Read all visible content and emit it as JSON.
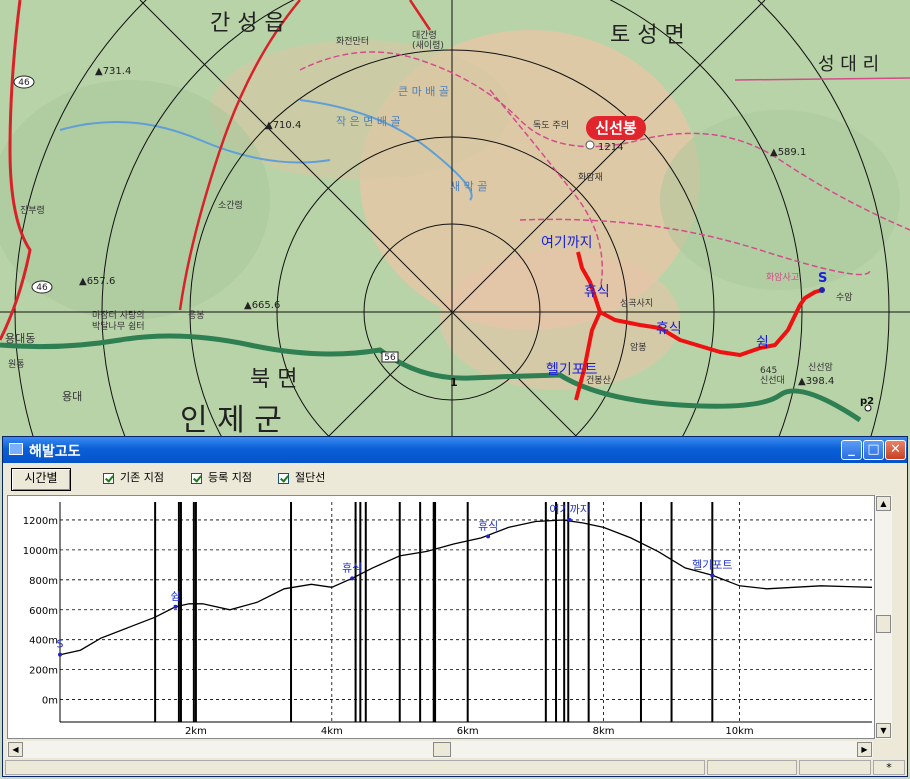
{
  "map": {
    "place_labels": {
      "gansung": "간 성 읍",
      "tosung": "토 성 면",
      "sungdaeri": "성 대 리",
      "bukmyeon": "북 면",
      "inje": "인 제 군",
      "sinseonbong": "신선봉",
      "elev_731": "▲731.4",
      "elev_710": "▲710.4",
      "elev_657": "▲657.6",
      "elev_665": "▲665.6",
      "elev_589": "▲589.1",
      "elev_398": "▲398.4",
      "elev_1214": "1214",
      "road_46a": "46",
      "road_46b": "46",
      "road_56": "56",
      "hwajeon": "화전만터",
      "daegan": "대간령",
      "saeibyeong": "(새이령)",
      "keunmaebong": "큰 마 배 골",
      "jakeunmyeon": "작 은 면 배 골",
      "saemaegol": "새 막 골",
      "dokdoju": "독도 주의",
      "hwaamjae": "화암재",
      "sosonggwan": "소간령",
      "jinburyeong": "진부령",
      "yongdaedong": "용대동",
      "yongdae": "용대",
      "wonbong": "원통",
      "madeun": "마장터 사랑의",
      "bakdal": "박달나무 쉼터",
      "eungbong": "응봉",
      "seongsa": "성곡사지",
      "ambong": "암봉",
      "hwaamsago": "화암사고",
      "suam": "수암",
      "sinseondae": "신선대",
      "sinseonam": "신선암",
      "num645": "645",
      "geonbong": "건봉산",
      "numone": "1",
      "p2": "p2"
    },
    "track_labels": {
      "yeogikkaji": "여기까지",
      "hyusik1": "휴식",
      "hyusik2": "휴식",
      "swim": "쉼",
      "start": "S",
      "helipad": "헬기포트"
    }
  },
  "window": {
    "title": "해발고도",
    "btn_min": "_",
    "btn_max": "□",
    "btn_close": "✕"
  },
  "toolbar": {
    "time_button": "시간별",
    "checkbox_base_point": "기존 지점",
    "checkbox_reg_point": "등록 지점",
    "checkbox_cut_line": "절단선"
  },
  "statusbar": {
    "asterisk": "*"
  },
  "icons": {
    "up": "up-arrow-icon",
    "down": "down-arrow-icon",
    "left": "left-arrow-icon",
    "right": "right-arrow-icon"
  },
  "chart_data": {
    "type": "line",
    "xlabel": "",
    "ylabel": "",
    "x_unit": "km",
    "xlim": [
      0,
      11.95
    ],
    "ylim": [
      -150,
      1320
    ],
    "yticks": [
      0,
      200,
      400,
      600,
      800,
      1000,
      1200
    ],
    "ytick_labels": [
      "0m",
      "200m",
      "400m",
      "600m",
      "800m",
      "1000m",
      "1200m"
    ],
    "xticks": [
      2,
      4,
      6,
      8,
      10
    ],
    "xtick_labels": [
      "2km",
      "4km",
      "6km",
      "8km",
      "10km"
    ],
    "grid": true,
    "series": [
      {
        "x": [
          0,
          0.3,
          0.6,
          1.0,
          1.4,
          1.7,
          1.9,
          2.1,
          2.5,
          2.9,
          3.3,
          3.7,
          4.0,
          4.3,
          4.6,
          5.0,
          5.4,
          5.8,
          6.2,
          6.6,
          7.0,
          7.4,
          7.7,
          8.0,
          8.4,
          8.8,
          9.2,
          9.6,
          10.0,
          10.4,
          10.8,
          11.2,
          11.6,
          11.95
        ],
        "y": [
          300,
          330,
          410,
          480,
          550,
          620,
          640,
          640,
          600,
          650,
          740,
          770,
          750,
          810,
          880,
          960,
          990,
          1040,
          1080,
          1150,
          1190,
          1200,
          1180,
          1150,
          1080,
          990,
          880,
          830,
          760,
          740,
          750,
          760,
          755,
          750
        ]
      }
    ],
    "point_labels": [
      {
        "x": 0.0,
        "y": 300,
        "text": "S"
      },
      {
        "x": 1.7,
        "y": 620,
        "text": "쉼"
      },
      {
        "x": 4.3,
        "y": 810,
        "text": "휴식"
      },
      {
        "x": 6.3,
        "y": 1090,
        "text": "휴식"
      },
      {
        "x": 7.5,
        "y": 1200,
        "text": "여기까지"
      },
      {
        "x": 9.6,
        "y": 830,
        "text": "헬기포트"
      }
    ],
    "cut_lines": [
      1.4,
      1.75,
      1.78,
      1.97,
      2.0,
      3.4,
      4.35,
      4.42,
      4.5,
      5.0,
      5.3,
      5.5,
      5.52,
      6.0,
      7.15,
      7.3,
      7.42,
      7.48,
      7.78,
      8.55,
      9.0,
      9.6
    ]
  }
}
